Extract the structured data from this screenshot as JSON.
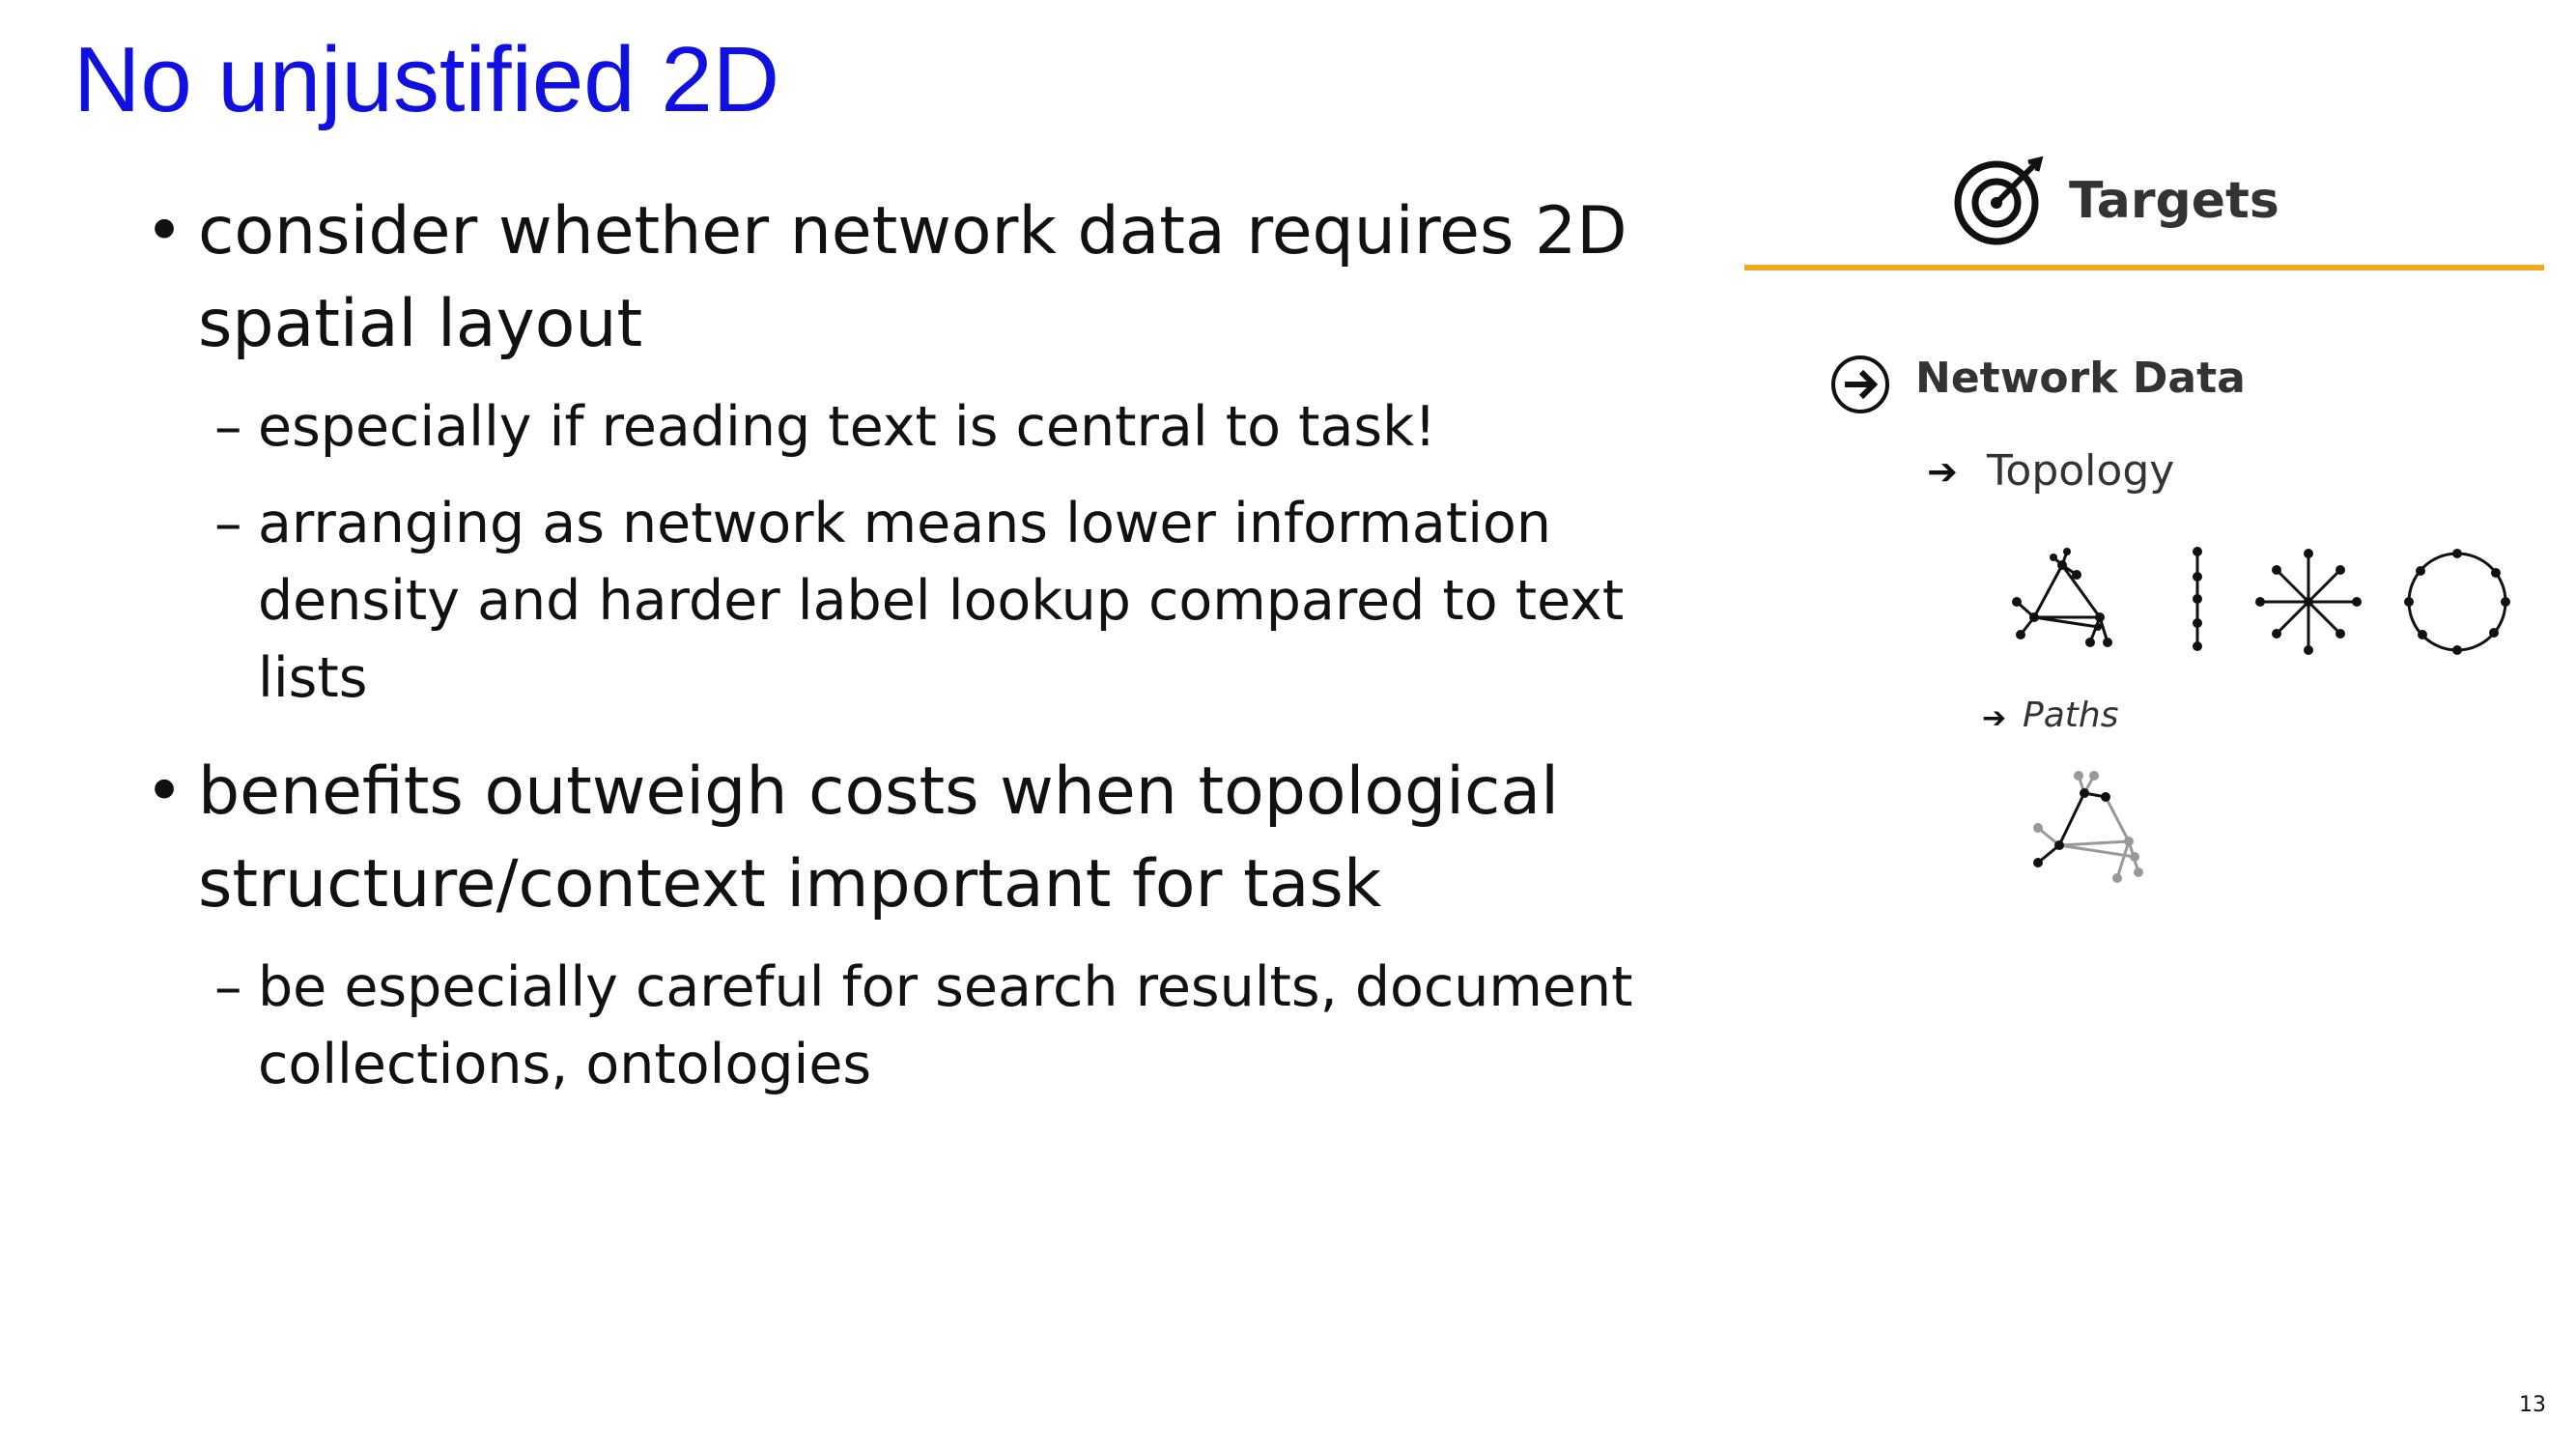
{
  "slide": {
    "title": "No unjustified 2D",
    "bullets": [
      {
        "text": "consider whether network data requires 2D spatial layout",
        "subs": [
          "especially if reading text is central to task!",
          "arranging as network means lower information density and harder label lookup compared to text lists"
        ]
      },
      {
        "text": "benefits outweigh costs when topological structure/context important for task",
        "subs": [
          "be especially careful for search results, document collections, ontologies"
        ]
      }
    ],
    "bullet_symbol": "•",
    "sub_symbol": "–",
    "page_number": "13"
  },
  "panel": {
    "header": "Targets",
    "header_icon": "target-icon",
    "accent_color": "#f2a81d",
    "section": "Network Data",
    "section_icon": "circled-arrow-icon",
    "items": [
      {
        "label": "Topology",
        "icon": "arrow-right-icon"
      },
      {
        "label": "Paths",
        "icon": "arrow-right-icon"
      }
    ],
    "glyphs": [
      "network-graph-icon",
      "linear-chain-icon",
      "star-graph-icon",
      "ring-graph-icon",
      "path-graph-icon"
    ],
    "arrow_glyph": "➔"
  }
}
